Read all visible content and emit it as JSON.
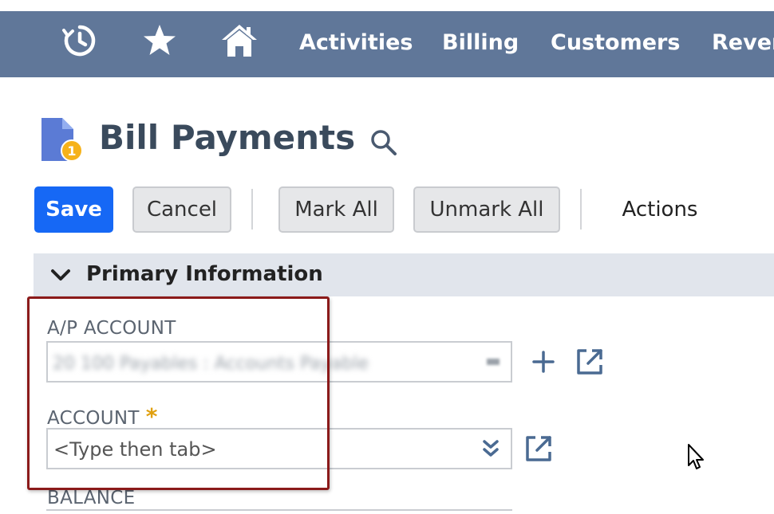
{
  "nav": {
    "icons": [
      "history-icon",
      "star-icon",
      "home-icon"
    ],
    "links": [
      "Activities",
      "Billing",
      "Customers",
      "Rever"
    ]
  },
  "page": {
    "title": "Bill Payments",
    "title_icon": "bill-payment-icon",
    "search_icon": "search-icon"
  },
  "toolbar": {
    "save_label": "Save",
    "cancel_label": "Cancel",
    "mark_all_label": "Mark All",
    "unmark_all_label": "Unmark All",
    "actions_label": "Actions"
  },
  "section": {
    "title": "Primary Information",
    "collapse_icon": "chevron-down-icon"
  },
  "fields": {
    "ap_account": {
      "label": "A/P ACCOUNT",
      "value": "20 100 Payables : Accounts Payable"
    },
    "account": {
      "label": "ACCOUNT",
      "required_marker": "*",
      "placeholder": "<Type then tab>"
    },
    "balance": {
      "label": "BALANCE"
    }
  },
  "colors": {
    "nav_bg": "#607799",
    "primary_button": "#1668f5",
    "highlight_border": "#8b1a1a",
    "required_star": "#e0a010"
  }
}
